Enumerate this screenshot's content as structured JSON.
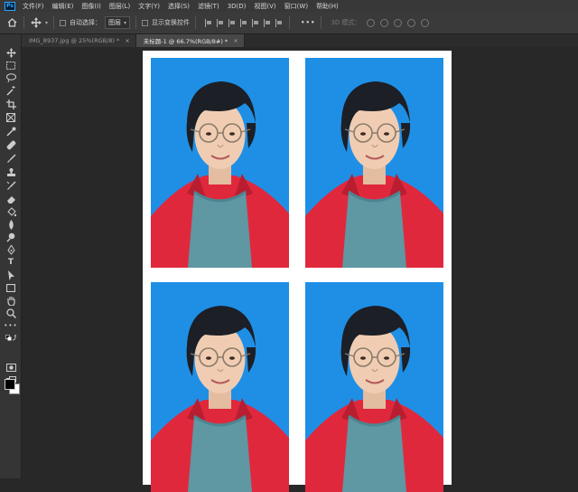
{
  "app": {
    "logo_text": "Ps"
  },
  "menu": [
    "文件(F)",
    "编辑(E)",
    "图像(I)",
    "图层(L)",
    "文字(Y)",
    "选择(S)",
    "滤镜(T)",
    "3D(D)",
    "视图(V)",
    "窗口(W)",
    "帮助(H)"
  ],
  "options_bar": {
    "auto_select_label": "自动选择：",
    "auto_select_value": "图层",
    "show_transform_label": "显示变换控件",
    "more_label": "•••",
    "mode_3d_label": "3D 模式："
  },
  "tabs": [
    {
      "label": "IMG_8937.jpg @ 25%(RGB/8) *",
      "close": "×",
      "active": false
    },
    {
      "label": "未标题-1 @ 66.7%(RGB/8#) *",
      "close": "×",
      "active": true
    }
  ],
  "tools": [
    "move-tool",
    "marquee-tool",
    "lasso-tool",
    "magic-wand-tool",
    "crop-tool",
    "frame-tool",
    "eyedropper-tool",
    "healing-brush-tool",
    "brush-tool",
    "clone-stamp-tool",
    "history-brush-tool",
    "eraser-tool",
    "paint-bucket-tool",
    "blur-tool",
    "dodge-tool",
    "pen-tool",
    "type-tool",
    "path-selection-tool",
    "rectangle-tool",
    "hand-tool",
    "zoom-tool",
    "edit-toolbar"
  ],
  "colors": {
    "photo_background": "#1f8fe6",
    "jacket": "#e0283d",
    "shirt": "#5f97a2",
    "foreground": "#000000",
    "background": "#ffffff"
  }
}
